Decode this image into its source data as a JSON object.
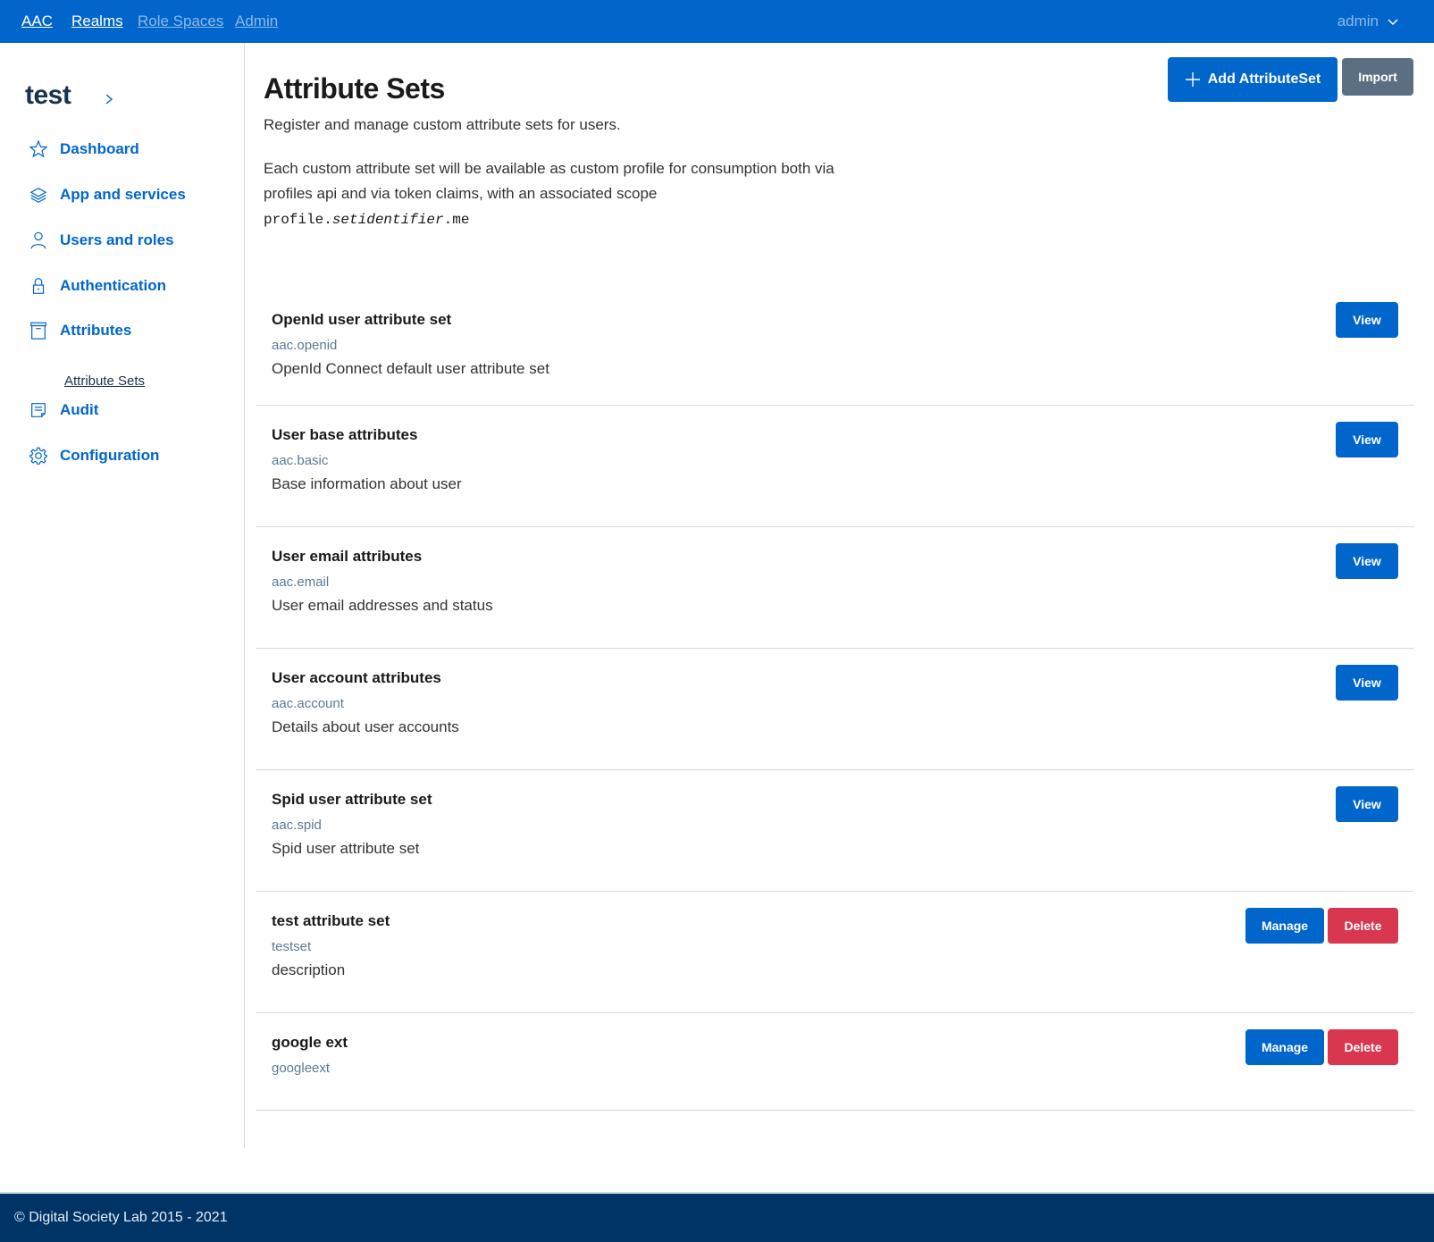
{
  "topnav": {
    "brand": "AAC",
    "items": [
      "Realms",
      "Role Spaces",
      "Admin"
    ],
    "user": "admin"
  },
  "sidebar": {
    "realm": "test",
    "items": [
      {
        "label": "Dashboard",
        "icon": "star-icon"
      },
      {
        "label": "App and services",
        "icon": "layers-icon"
      },
      {
        "label": "Users and roles",
        "icon": "user-icon"
      },
      {
        "label": "Authentication",
        "icon": "lock-icon"
      },
      {
        "label": "Attributes",
        "icon": "archive-icon"
      },
      {
        "label": "Audit",
        "icon": "note-icon"
      },
      {
        "label": "Configuration",
        "icon": "gear-icon"
      }
    ],
    "sub_item": "Attribute Sets"
  },
  "header": {
    "title": "Attribute Sets",
    "subtitle": "Register and manage custom attribute sets for users.",
    "description": "Each custom attribute set will be available as custom profile for consumption both via profiles api and via token claims, with an associated scope",
    "scope_prefix": "profile.",
    "scope_var": "setidentifier",
    "scope_suffix": ".me",
    "add_button": "Add AttributeSet",
    "import_button": "Import"
  },
  "attribute_sets": [
    {
      "name": "OpenId user attribute set",
      "id": "aac.openid",
      "description": "OpenId Connect default user attribute set",
      "actions": [
        "View"
      ]
    },
    {
      "name": "User base attributes",
      "id": "aac.basic",
      "description": "Base information about user",
      "actions": [
        "View"
      ]
    },
    {
      "name": "User email attributes",
      "id": "aac.email",
      "description": "User email addresses and status",
      "actions": [
        "View"
      ]
    },
    {
      "name": "User account attributes",
      "id": "aac.account",
      "description": "Details about user accounts",
      "actions": [
        "View"
      ]
    },
    {
      "name": "Spid user attribute set",
      "id": "aac.spid",
      "description": "Spid user attribute set",
      "actions": [
        "View"
      ]
    },
    {
      "name": "test attribute set",
      "id": "testset",
      "description": "description",
      "actions": [
        "Manage",
        "Delete"
      ]
    },
    {
      "name": "google ext",
      "id": "googleext",
      "description": "",
      "actions": [
        "Manage",
        "Delete"
      ]
    }
  ],
  "footer": {
    "copyright": "© Digital Society Lab 2015 - 2021"
  },
  "colors": {
    "primary": "#0066cc",
    "danger": "#d9364f",
    "secondary": "#5c6f82",
    "footer": "#003366"
  }
}
